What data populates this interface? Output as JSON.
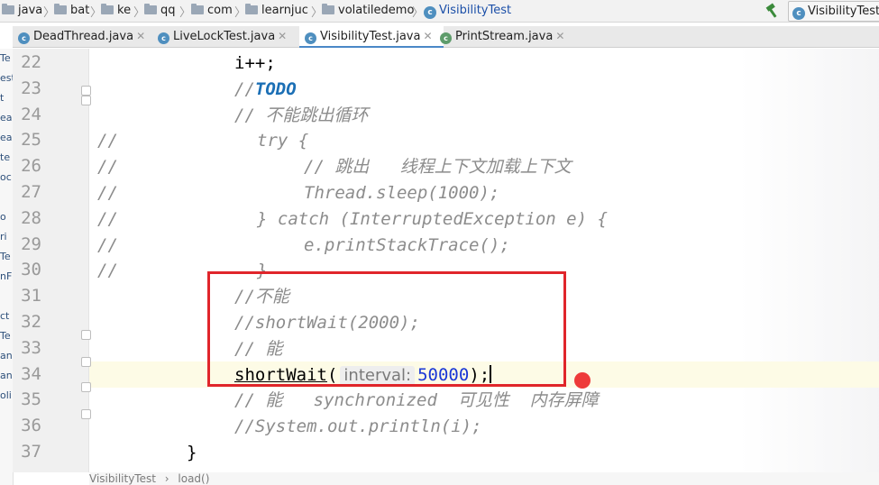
{
  "navbar": {
    "breadcrumbs": [
      "java",
      "bat",
      "ke",
      "qq",
      "com",
      "learnjuc",
      "volatiledemo",
      "VisibilityTest"
    ],
    "run_config": "VisibilityTest"
  },
  "tabs": [
    {
      "label": "DeadThread.java",
      "icon": "java-class-icon"
    },
    {
      "label": "LiveLockTest.java",
      "icon": "java-class-icon"
    },
    {
      "label": "VisibilityTest.java",
      "icon": "java-class-icon",
      "active": true
    },
    {
      "label": "PrintStream.java",
      "icon": "java-class-icon"
    }
  ],
  "sidebar_fragments": [
    "Te",
    "est",
    "t",
    "ea",
    "ea",
    "te",
    "oc",
    "",
    "o",
    "ri",
    "Te",
    "nF",
    "",
    "ct",
    "Te",
    "an",
    "an",
    "oli"
  ],
  "editor": {
    "lines": [
      {
        "n": "22",
        "prefix": "",
        "text": "i++;"
      },
      {
        "n": "23",
        "prefix": "",
        "comment": "//",
        "todo": "TODO"
      },
      {
        "n": "24",
        "prefix": "",
        "text": "// 不能跳出循环"
      },
      {
        "n": "25",
        "prefix": "//",
        "text": "try {"
      },
      {
        "n": "26",
        "prefix": "//",
        "text": "// 跳出   线程上下文加载上下文"
      },
      {
        "n": "27",
        "prefix": "//",
        "text": "Thread.sleep(1000);"
      },
      {
        "n": "28",
        "prefix": "//",
        "text": "} catch (InterruptedException e) {"
      },
      {
        "n": "29",
        "prefix": "//",
        "text": "e.printStackTrace();"
      },
      {
        "n": "30",
        "prefix": "//",
        "text": "}"
      },
      {
        "n": "31",
        "prefix": "",
        "text": "//不能"
      },
      {
        "n": "32",
        "prefix": "",
        "text": "//shortWait(2000);"
      },
      {
        "n": "33",
        "prefix": "",
        "text": "// 能"
      },
      {
        "n": "34",
        "prefix": "",
        "method": "shortWait",
        "open": "(",
        "hint": "interval:",
        "arg": "50000",
        "close": ");"
      },
      {
        "n": "35",
        "prefix": "",
        "text": "// 能   synchronized  可见性  内存屏障"
      },
      {
        "n": "36",
        "prefix": "",
        "text": "//System.out.println(i);"
      },
      {
        "n": "37",
        "prefix": "",
        "text": "}"
      }
    ]
  },
  "statusbar": {
    "path": [
      "VisibilityTest",
      "load()"
    ]
  },
  "colors": {
    "highlight_box": "#e0252b",
    "breakpoint_dot": "#ee3a3a",
    "todo": "#1b6fb5",
    "number": "#1a38d6"
  }
}
